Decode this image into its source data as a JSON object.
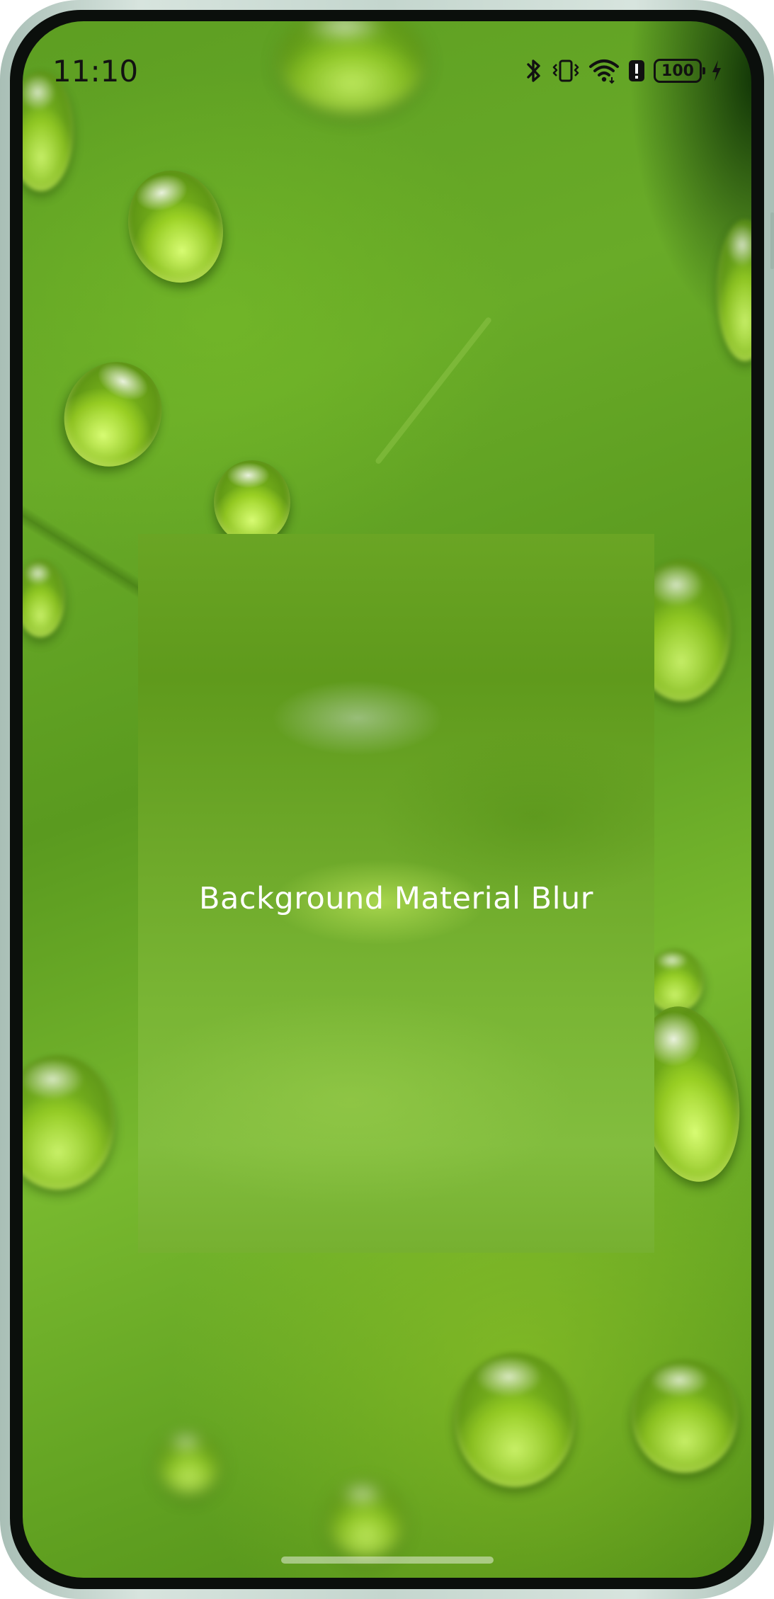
{
  "status_bar": {
    "time": "11:10",
    "icons": [
      "bluetooth-icon",
      "vibrate-icon",
      "wifi-icon",
      "battery-alert-icon",
      "battery-icon",
      "charging-icon"
    ],
    "battery_level": "100"
  },
  "panel": {
    "label": "Background Material Blur"
  },
  "colors": {
    "leaf_green": "#5f9f20",
    "panel_green": "#6ea92a",
    "label_text": "#ffffff"
  }
}
